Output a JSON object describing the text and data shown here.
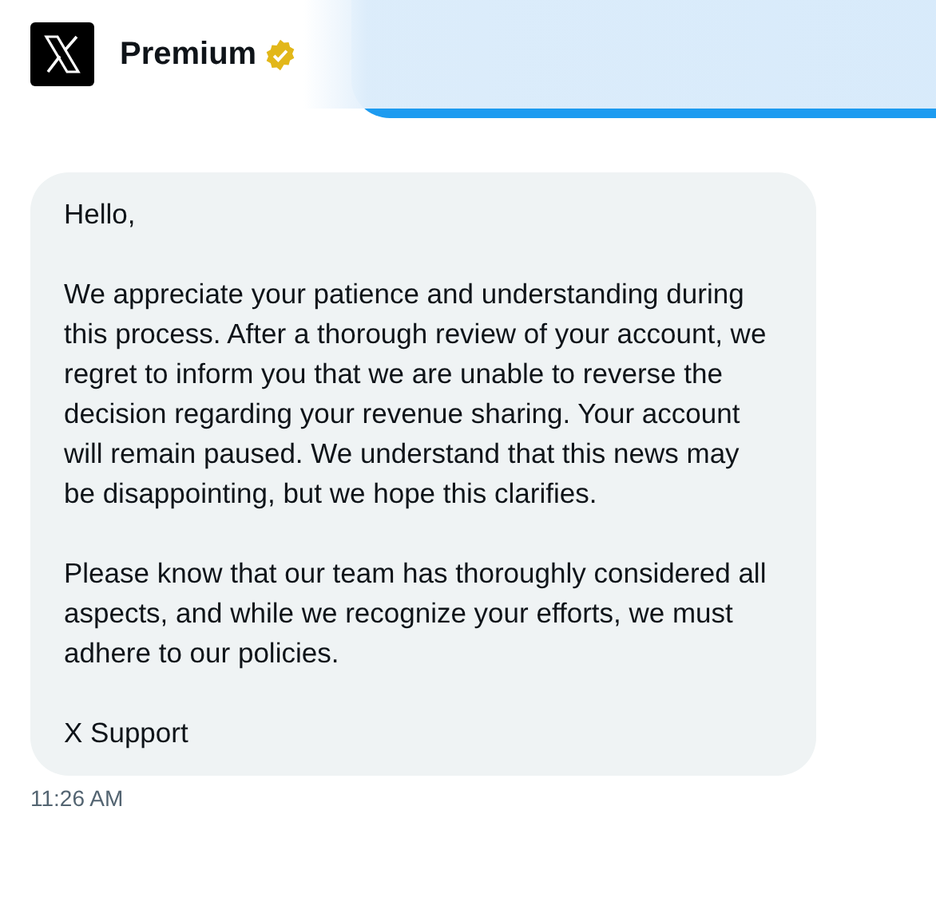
{
  "header": {
    "title": "Premium",
    "verified": true
  },
  "message": {
    "paragraphs": [
      "Hello,",
      "We appreciate your patience and understanding during this process. After a thorough review of your account, we regret to inform you that we are unable to reverse the decision regarding your revenue sharing. Your account will remain paused. We understand that this news may be disappointing, but we hope this clarifies.",
      "Please know that our team has thoroughly considered all aspects, and while we recognize your efforts, we must adhere to our policies.",
      "X Support"
    ],
    "time": "11:26 AM"
  }
}
